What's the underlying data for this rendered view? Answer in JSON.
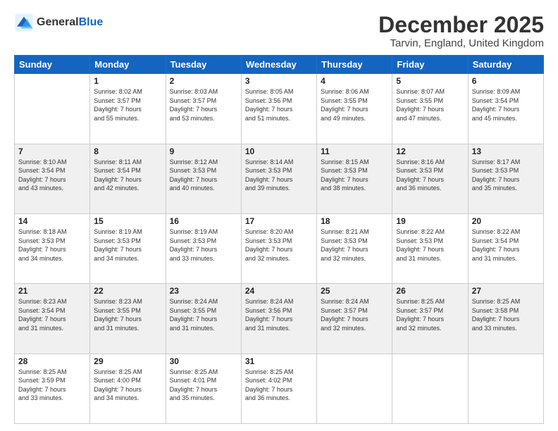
{
  "logo": {
    "general": "General",
    "blue": "Blue"
  },
  "title": "December 2025",
  "subtitle": "Tarvin, England, United Kingdom",
  "weekdays": [
    "Sunday",
    "Monday",
    "Tuesday",
    "Wednesday",
    "Thursday",
    "Friday",
    "Saturday"
  ],
  "weeks": [
    [
      {
        "day": "",
        "sunrise": "",
        "sunset": "",
        "daylight": ""
      },
      {
        "day": "1",
        "sunrise": "Sunrise: 8:02 AM",
        "sunset": "Sunset: 3:57 PM",
        "daylight": "Daylight: 7 hours and 55 minutes."
      },
      {
        "day": "2",
        "sunrise": "Sunrise: 8:03 AM",
        "sunset": "Sunset: 3:57 PM",
        "daylight": "Daylight: 7 hours and 53 minutes."
      },
      {
        "day": "3",
        "sunrise": "Sunrise: 8:05 AM",
        "sunset": "Sunset: 3:56 PM",
        "daylight": "Daylight: 7 hours and 51 minutes."
      },
      {
        "day": "4",
        "sunrise": "Sunrise: 8:06 AM",
        "sunset": "Sunset: 3:55 PM",
        "daylight": "Daylight: 7 hours and 49 minutes."
      },
      {
        "day": "5",
        "sunrise": "Sunrise: 8:07 AM",
        "sunset": "Sunset: 3:55 PM",
        "daylight": "Daylight: 7 hours and 47 minutes."
      },
      {
        "day": "6",
        "sunrise": "Sunrise: 8:09 AM",
        "sunset": "Sunset: 3:54 PM",
        "daylight": "Daylight: 7 hours and 45 minutes."
      }
    ],
    [
      {
        "day": "7",
        "sunrise": "Sunrise: 8:10 AM",
        "sunset": "Sunset: 3:54 PM",
        "daylight": "Daylight: 7 hours and 43 minutes."
      },
      {
        "day": "8",
        "sunrise": "Sunrise: 8:11 AM",
        "sunset": "Sunset: 3:54 PM",
        "daylight": "Daylight: 7 hours and 42 minutes."
      },
      {
        "day": "9",
        "sunrise": "Sunrise: 8:12 AM",
        "sunset": "Sunset: 3:53 PM",
        "daylight": "Daylight: 7 hours and 40 minutes."
      },
      {
        "day": "10",
        "sunrise": "Sunrise: 8:14 AM",
        "sunset": "Sunset: 3:53 PM",
        "daylight": "Daylight: 7 hours and 39 minutes."
      },
      {
        "day": "11",
        "sunrise": "Sunrise: 8:15 AM",
        "sunset": "Sunset: 3:53 PM",
        "daylight": "Daylight: 7 hours and 38 minutes."
      },
      {
        "day": "12",
        "sunrise": "Sunrise: 8:16 AM",
        "sunset": "Sunset: 3:53 PM",
        "daylight": "Daylight: 7 hours and 36 minutes."
      },
      {
        "day": "13",
        "sunrise": "Sunrise: 8:17 AM",
        "sunset": "Sunset: 3:53 PM",
        "daylight": "Daylight: 7 hours and 35 minutes."
      }
    ],
    [
      {
        "day": "14",
        "sunrise": "Sunrise: 8:18 AM",
        "sunset": "Sunset: 3:53 PM",
        "daylight": "Daylight: 7 hours and 34 minutes."
      },
      {
        "day": "15",
        "sunrise": "Sunrise: 8:19 AM",
        "sunset": "Sunset: 3:53 PM",
        "daylight": "Daylight: 7 hours and 34 minutes."
      },
      {
        "day": "16",
        "sunrise": "Sunrise: 8:19 AM",
        "sunset": "Sunset: 3:53 PM",
        "daylight": "Daylight: 7 hours and 33 minutes."
      },
      {
        "day": "17",
        "sunrise": "Sunrise: 8:20 AM",
        "sunset": "Sunset: 3:53 PM",
        "daylight": "Daylight: 7 hours and 32 minutes."
      },
      {
        "day": "18",
        "sunrise": "Sunrise: 8:21 AM",
        "sunset": "Sunset: 3:53 PM",
        "daylight": "Daylight: 7 hours and 32 minutes."
      },
      {
        "day": "19",
        "sunrise": "Sunrise: 8:22 AM",
        "sunset": "Sunset: 3:53 PM",
        "daylight": "Daylight: 7 hours and 31 minutes."
      },
      {
        "day": "20",
        "sunrise": "Sunrise: 8:22 AM",
        "sunset": "Sunset: 3:54 PM",
        "daylight": "Daylight: 7 hours and 31 minutes."
      }
    ],
    [
      {
        "day": "21",
        "sunrise": "Sunrise: 8:23 AM",
        "sunset": "Sunset: 3:54 PM",
        "daylight": "Daylight: 7 hours and 31 minutes."
      },
      {
        "day": "22",
        "sunrise": "Sunrise: 8:23 AM",
        "sunset": "Sunset: 3:55 PM",
        "daylight": "Daylight: 7 hours and 31 minutes."
      },
      {
        "day": "23",
        "sunrise": "Sunrise: 8:24 AM",
        "sunset": "Sunset: 3:55 PM",
        "daylight": "Daylight: 7 hours and 31 minutes."
      },
      {
        "day": "24",
        "sunrise": "Sunrise: 8:24 AM",
        "sunset": "Sunset: 3:56 PM",
        "daylight": "Daylight: 7 hours and 31 minutes."
      },
      {
        "day": "25",
        "sunrise": "Sunrise: 8:24 AM",
        "sunset": "Sunset: 3:57 PM",
        "daylight": "Daylight: 7 hours and 32 minutes."
      },
      {
        "day": "26",
        "sunrise": "Sunrise: 8:25 AM",
        "sunset": "Sunset: 3:57 PM",
        "daylight": "Daylight: 7 hours and 32 minutes."
      },
      {
        "day": "27",
        "sunrise": "Sunrise: 8:25 AM",
        "sunset": "Sunset: 3:58 PM",
        "daylight": "Daylight: 7 hours and 33 minutes."
      }
    ],
    [
      {
        "day": "28",
        "sunrise": "Sunrise: 8:25 AM",
        "sunset": "Sunset: 3:59 PM",
        "daylight": "Daylight: 7 hours and 33 minutes."
      },
      {
        "day": "29",
        "sunrise": "Sunrise: 8:25 AM",
        "sunset": "Sunset: 4:00 PM",
        "daylight": "Daylight: 7 hours and 34 minutes."
      },
      {
        "day": "30",
        "sunrise": "Sunrise: 8:25 AM",
        "sunset": "Sunset: 4:01 PM",
        "daylight": "Daylight: 7 hours and 35 minutes."
      },
      {
        "day": "31",
        "sunrise": "Sunrise: 8:25 AM",
        "sunset": "Sunset: 4:02 PM",
        "daylight": "Daylight: 7 hours and 36 minutes."
      },
      {
        "day": "",
        "sunrise": "",
        "sunset": "",
        "daylight": ""
      },
      {
        "day": "",
        "sunrise": "",
        "sunset": "",
        "daylight": ""
      },
      {
        "day": "",
        "sunrise": "",
        "sunset": "",
        "daylight": ""
      }
    ]
  ]
}
